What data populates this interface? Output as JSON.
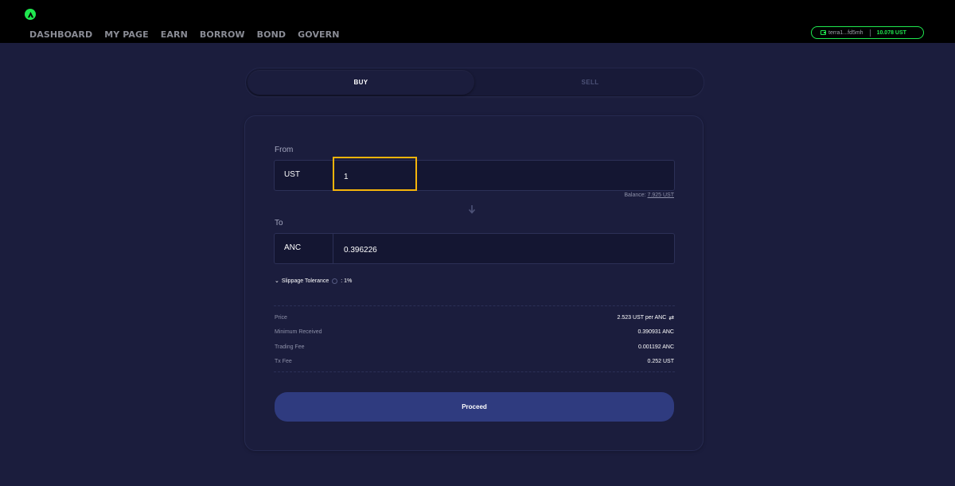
{
  "header": {
    "nav": [
      "DASHBOARD",
      "MY PAGE",
      "EARN",
      "BORROW",
      "BOND",
      "GOVERN"
    ],
    "wallet_address": "terra1...fd5mh",
    "wallet_balance": "10.078 UST"
  },
  "tabs": {
    "buy": "BUY",
    "sell": "SELL"
  },
  "form": {
    "from_label": "From",
    "from_token": "UST",
    "from_value": "1",
    "balance_label": "Balance:",
    "balance_value": "7.925 UST",
    "to_label": "To",
    "to_token": "ANC",
    "to_value": "0.396226",
    "slippage_label": "Slippage Tolerance",
    "slippage_value": ": 1%"
  },
  "details": [
    {
      "key": "Price",
      "value": "2.523 UST per ANC"
    },
    {
      "key": "Minimum Received",
      "value": "0.390931 ANC"
    },
    {
      "key": "Trading Fee",
      "value": "0.001192 ANC"
    },
    {
      "key": "Tx Fee",
      "value": "0.252 UST"
    }
  ],
  "proceed_label": "Proceed",
  "colors": {
    "background": "#1b1d3d",
    "accent_green": "#1fe84f",
    "highlight": "#f5b40b",
    "button": "#2f3b7f"
  }
}
